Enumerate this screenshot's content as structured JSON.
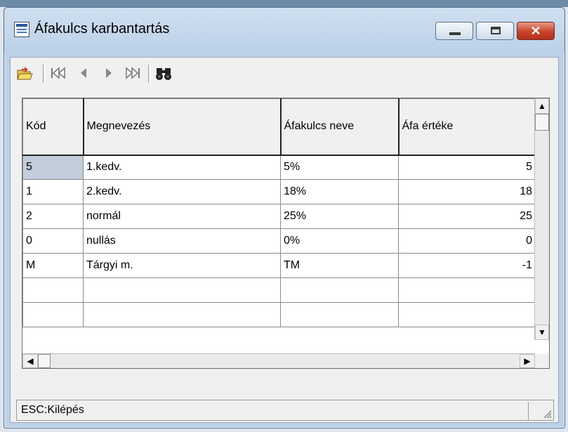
{
  "window": {
    "title": "Áfakulcs karbantartás",
    "close_glyph": "✕"
  },
  "toolbar": {
    "icons": [
      "open-folder-icon",
      "first-record-icon",
      "prev-record-icon",
      "next-record-icon",
      "last-record-icon",
      "binoculars-find-icon"
    ]
  },
  "grid": {
    "headers": [
      "Kód",
      "Megnevezés",
      "Áfakulcs neve",
      "Áfa értéke"
    ],
    "rows": [
      {
        "kod": "5",
        "megnevezes": "1.kedv.",
        "afakulcs": "5%",
        "ertek": "5"
      },
      {
        "kod": "1",
        "megnevezes": "2.kedv.",
        "afakulcs": "18%",
        "ertek": "18"
      },
      {
        "kod": "2",
        "megnevezes": "normál",
        "afakulcs": "25%",
        "ertek": "25"
      },
      {
        "kod": "0",
        "megnevezes": "nullás",
        "afakulcs": "0%",
        "ertek": "0"
      },
      {
        "kod": "M",
        "megnevezes": "Tárgyi m.",
        "afakulcs": "TM",
        "ertek": "-1"
      },
      {
        "kod": "",
        "megnevezes": "",
        "afakulcs": "",
        "ertek": ""
      },
      {
        "kod": "",
        "megnevezes": "",
        "afakulcs": "",
        "ertek": ""
      }
    ],
    "selected_row": 0
  },
  "status": {
    "text": "ESC:Kilépés"
  },
  "colors": {
    "selected_cell": "#c2cddb",
    "close_button": "#c8432a"
  }
}
